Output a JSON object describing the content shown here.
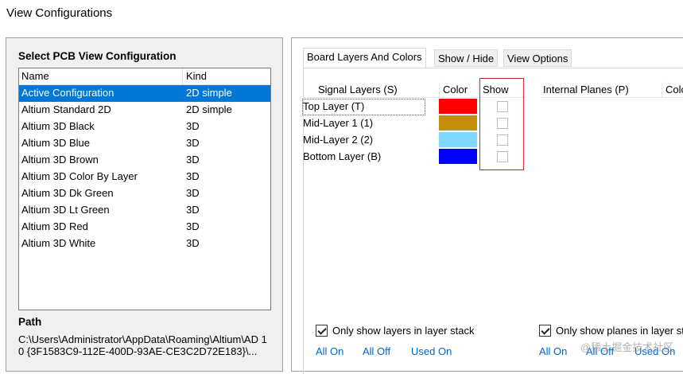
{
  "window": {
    "title": "View Configurations"
  },
  "left": {
    "title": "Select PCB View Configuration",
    "columns": {
      "name": "Name",
      "kind": "Kind"
    },
    "rows": [
      {
        "name": "Active Configuration",
        "kind": "2D simple",
        "selected": true
      },
      {
        "name": "Altium Standard 2D",
        "kind": "2D simple"
      },
      {
        "name": "Altium 3D Black",
        "kind": "3D"
      },
      {
        "name": "Altium 3D Blue",
        "kind": "3D"
      },
      {
        "name": "Altium 3D Brown",
        "kind": "3D"
      },
      {
        "name": "Altium 3D Color By Layer",
        "kind": "3D"
      },
      {
        "name": "Altium 3D Dk Green",
        "kind": "3D"
      },
      {
        "name": "Altium 3D Lt Green",
        "kind": "3D"
      },
      {
        "name": "Altium 3D Red",
        "kind": "3D"
      },
      {
        "name": "Altium 3D White",
        "kind": "3D"
      }
    ],
    "path_label": "Path",
    "path_value": "C:\\Users\\Administrator\\AppData\\Roaming\\Altium\\AD 10 {3F1583C9-112E-400D-93AE-CE3C2D72E183}\\..."
  },
  "tabs": [
    {
      "label": "Board Layers And Colors",
      "active": true
    },
    {
      "label": "Show / Hide"
    },
    {
      "label": "View Options"
    }
  ],
  "signal_layers": {
    "headers": {
      "layers": "Signal Layers (S)",
      "color": "Color",
      "show": "Show"
    },
    "rows": [
      {
        "name": "Top Layer (T)",
        "color": "#ff0000",
        "shown": false
      },
      {
        "name": "Mid-Layer 1 (1)",
        "color": "#c38f0b",
        "shown": false
      },
      {
        "name": "Mid-Layer 2 (2)",
        "color": "#7fd6ff",
        "shown": false
      },
      {
        "name": "Bottom Layer (B)",
        "color": "#0000ff",
        "shown": false
      }
    ]
  },
  "internal_planes": {
    "headers": {
      "planes": "Internal Planes (P)",
      "color": "Color"
    }
  },
  "options": {
    "only_layers_label": "Only show layers in layer stack",
    "only_planes_label": "Only show planes in layer stack",
    "all_on": "All On",
    "all_off": "All Off",
    "used_on": "Used On"
  },
  "watermark": "@稀土掘金技术社区"
}
